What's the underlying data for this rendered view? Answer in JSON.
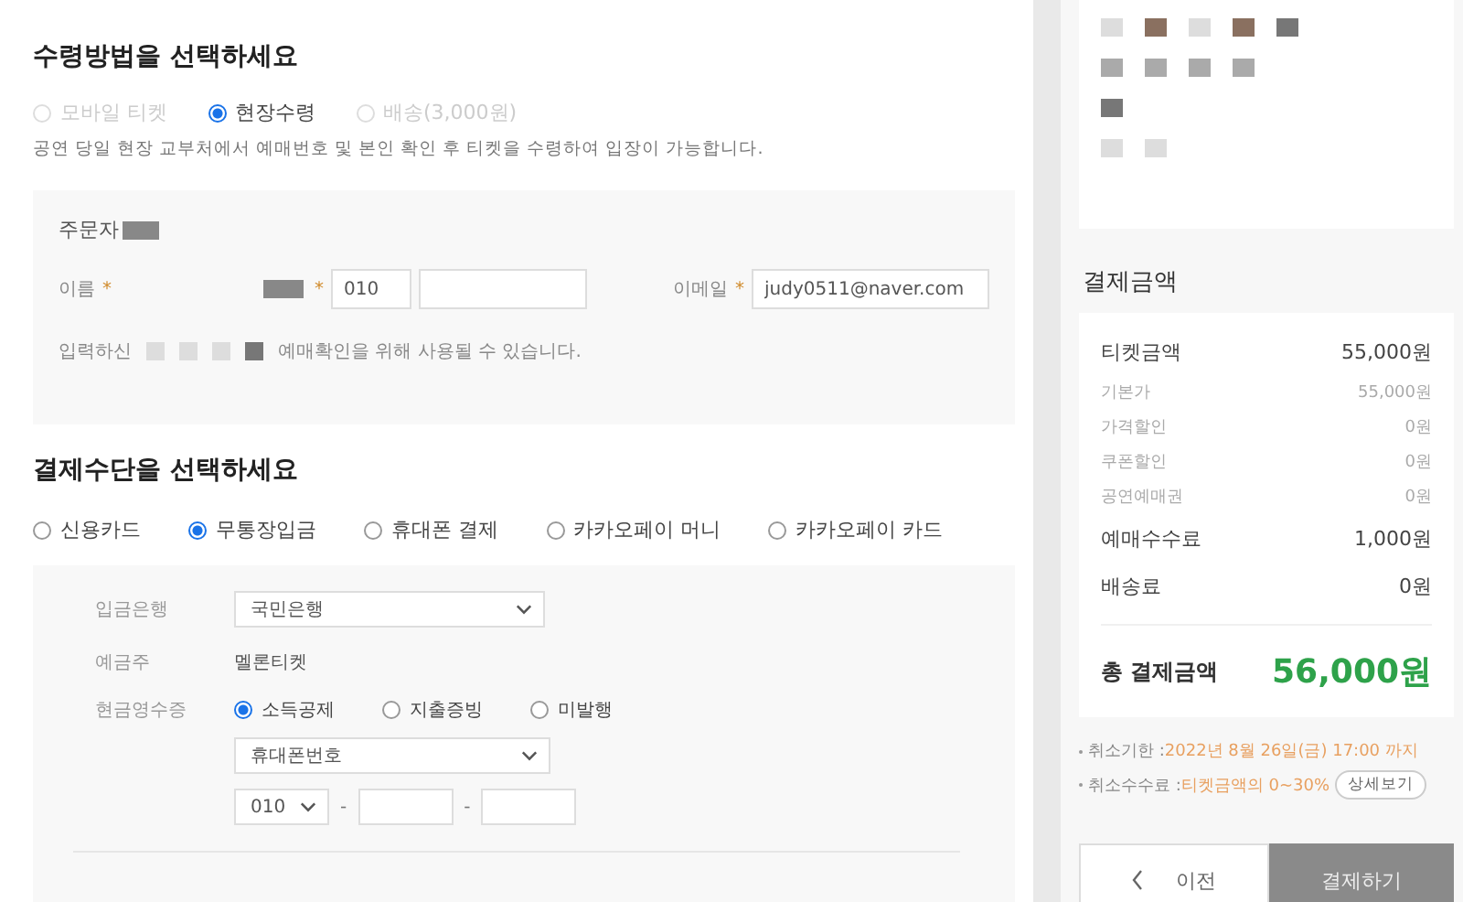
{
  "receipt": {
    "title": "수령방법을 선택하세요",
    "options": [
      {
        "label": "모바일 티켓",
        "selected": false,
        "disabled": true
      },
      {
        "label": "현장수령",
        "selected": true,
        "disabled": false
      },
      {
        "label": "배송(3,000원)",
        "selected": false,
        "disabled": true
      }
    ],
    "note": "공연 당일 현장 교부처에서 예매번호 및 본인 확인 후 티켓을 수령하여 입장이 가능합니다."
  },
  "orderer": {
    "title": "주문자",
    "fields": [
      {
        "kind": "name",
        "label": "이름",
        "mark": "*"
      },
      {
        "kind": "phone",
        "mark": "*",
        "value": "010"
      },
      {
        "kind": "email",
        "label": "이메일",
        "mark": "*",
        "value": "judy0511@naver.com"
      }
    ],
    "notice_start": "입력하신",
    "notice_end": "예매확인을 위해 사용될 수 있습니다."
  },
  "payment": {
    "title": "결제수단을 선택하세요",
    "methods": [
      {
        "label": "신용카드",
        "selected": false
      },
      {
        "label": "무통장입금",
        "selected": true
      },
      {
        "label": "휴대폰 결제",
        "selected": false
      },
      {
        "label": "카카오페이 머니",
        "selected": false
      },
      {
        "label": "카카오페이 카드",
        "selected": false
      }
    ],
    "bank_label": "입금은행",
    "bank_value": "국민은행",
    "holder_label": "예금주",
    "holder_value": "멜론티켓",
    "receipt_label": "현금영수증",
    "receipt_options": [
      {
        "label": "소득공제",
        "selected": true
      },
      {
        "label": "지출증빙",
        "selected": false
      },
      {
        "label": "미발행",
        "selected": false
      }
    ],
    "id_type": "휴대폰번호",
    "phone_prefix": "010",
    "separator": "-"
  },
  "summary": {
    "title": "결제금액",
    "rows": [
      {
        "kind": "main",
        "label": "티켓금액",
        "value": "55,000원"
      },
      {
        "kind": "sub",
        "label": "기본가",
        "value": "55,000원"
      },
      {
        "kind": "sub",
        "label": "가격할인",
        "value": "0원"
      },
      {
        "kind": "sub",
        "label": "쿠폰할인",
        "value": "0원"
      },
      {
        "kind": "sub",
        "label": "공연예매권",
        "value": "0원"
      },
      {
        "kind": "main",
        "label": "예매수수료",
        "value": "1,000원"
      },
      {
        "kind": "main",
        "label": "배송료",
        "value": "0원"
      }
    ],
    "total_label": "총 결제금액",
    "total_value": "56,000원",
    "notes": [
      {
        "label": "취소기한 : ",
        "value": "2022년 8월 26일(금) 17:00 까지"
      },
      {
        "label": "취소수수료 : ",
        "value": "티켓금액의 0~30%",
        "button": "상세보기"
      }
    ]
  },
  "buttons": {
    "prev": "이전",
    "pay": "결제하기"
  }
}
